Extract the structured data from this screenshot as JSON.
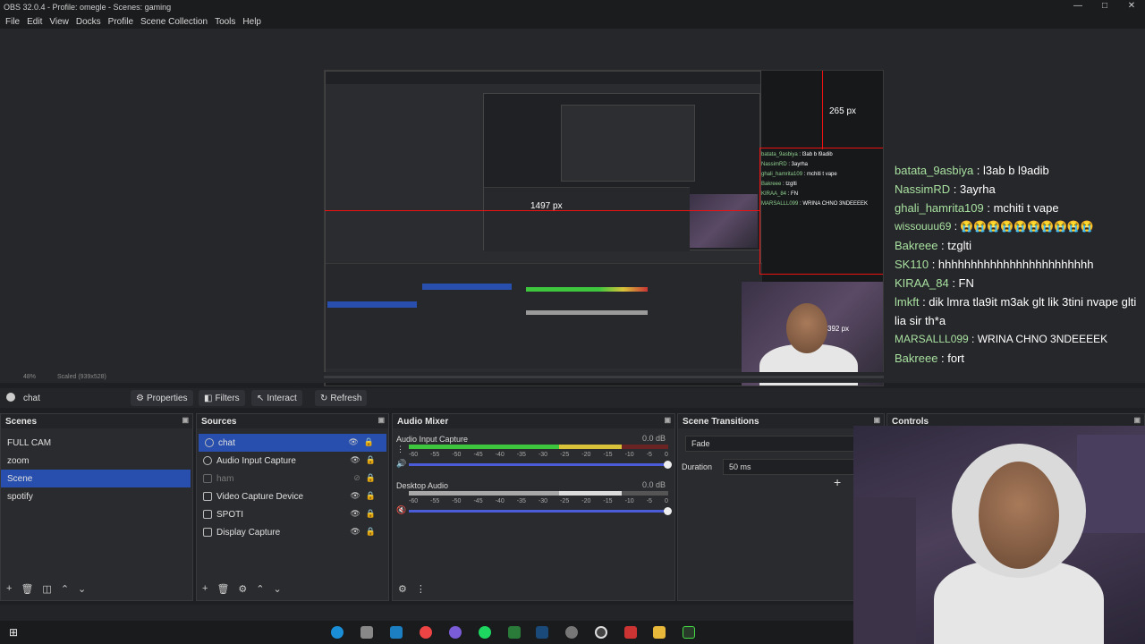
{
  "window": {
    "title": "OBS 32.0.4 - Profile: omegle - Scenes: gaming",
    "min": "—",
    "max": "□",
    "close": "✕"
  },
  "menu": [
    "File",
    "Edit",
    "View",
    "Docks",
    "Profile",
    "Scene Collection",
    "Tools",
    "Help"
  ],
  "preview": {
    "measure_top": "265 px",
    "measure_left": "1497 px",
    "measure_cam": "392 px",
    "zoom_label": "48%",
    "scaled_label": "Scaled (939x528)"
  },
  "chat": [
    {
      "user": "batata_9asbiya",
      "msg": " : l3ab b l9adib"
    },
    {
      "user": "NassimRD",
      "msg": " : 3ayrha"
    },
    {
      "user": "ghali_hamrita109",
      "msg": " : mchiti t vape"
    },
    {
      "user": "wissouuu69",
      "msg": " : 😭😭😭😭😭😭😭😭😭😭"
    },
    {
      "user": "Bakreee",
      "msg": " : tzglti"
    },
    {
      "user": "SK110",
      "msg": " : hhhhhhhhhhhhhhhhhhhhhhhh"
    },
    {
      "user": "KIRAA_84",
      "msg": " : FN"
    },
    {
      "user": "lmkft",
      "msg": " : dik lmra tla9it m3ak glt lik 3tini nvape glti lia sir th*a"
    },
    {
      "user": "MARSALLL099",
      "msg": " : WRINA CHNO 3NDEEEEK"
    },
    {
      "user": "Bakreee",
      "msg": " : fort"
    }
  ],
  "source_bar": {
    "selected_source": "chat",
    "properties": "Properties",
    "filters": "Filters",
    "interact": "Interact",
    "refresh": "Refresh"
  },
  "scenes": {
    "title": "Scenes",
    "items": [
      "FULL CAM",
      "zoom",
      "Scene",
      "spotify"
    ],
    "selected": "Scene"
  },
  "sources": {
    "title": "Sources",
    "items": [
      "chat",
      "Audio Input Capture",
      "ham",
      "Video Capture Device",
      "SPOTI",
      "Display Capture"
    ]
  },
  "mixer": {
    "title": "Audio Mixer",
    "channels": [
      {
        "name": "Audio Input Capture",
        "db": "0.0 dB"
      },
      {
        "name": "Desktop Audio",
        "db": "0.0 dB"
      }
    ],
    "scale": [
      "-60",
      "-55",
      "-50",
      "-45",
      "-40",
      "-35",
      "-30",
      "-25",
      "-20",
      "-15",
      "-10",
      "-5",
      "0"
    ]
  },
  "transitions": {
    "title": "Scene Transitions",
    "transition": "Fade",
    "duration_label": "Duration",
    "duration_value": "50 ms"
  },
  "controls": {
    "title": "Controls"
  },
  "colors": {
    "accent": "#284fae",
    "meter_green": "#3ec63e",
    "meter_yellow": "#d8c23a",
    "meter_red": "#c93434",
    "measure_red": "#ee1111"
  }
}
